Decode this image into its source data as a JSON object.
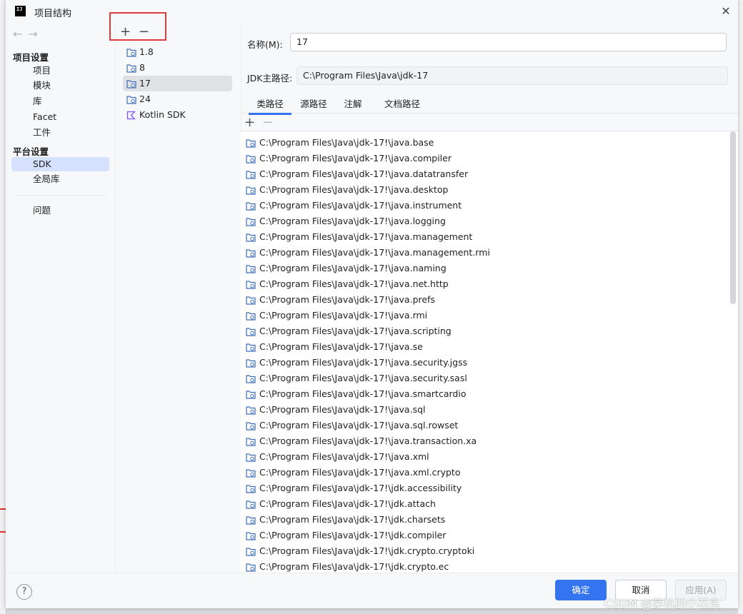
{
  "window": {
    "title": "项目结构",
    "close": "✕"
  },
  "nav": {
    "back": "←",
    "forward": "→",
    "section_project": "项目设置",
    "project_items": [
      "项目",
      "模块",
      "库",
      "Facet",
      "工件"
    ],
    "section_platform": "平台设置",
    "platform_items": [
      "SDK",
      "全局库"
    ],
    "problems": "问题",
    "selected": "SDK"
  },
  "sdk_panel": {
    "add": "+",
    "remove": "−",
    "items": [
      {
        "label": "1.8",
        "icon": "jdk-folder-icon"
      },
      {
        "label": "8",
        "icon": "jdk-folder-icon"
      },
      {
        "label": "17",
        "icon": "jdk-folder-icon"
      },
      {
        "label": "24",
        "icon": "jdk-folder-icon"
      },
      {
        "label": "Kotlin SDK",
        "icon": "kotlin-icon"
      }
    ],
    "selected": "17"
  },
  "detail": {
    "name_label": "名称(M):",
    "name_value": "17",
    "home_label": "JDK主路径:",
    "home_value": "C:\\Program Files\\Java\\jdk-17",
    "tabs": [
      "类路径",
      "源路径",
      "注解",
      "文档路径"
    ],
    "active_tab": "类路径",
    "list_add": "+",
    "list_remove": "−",
    "classpath": [
      "C:\\Program Files\\Java\\jdk-17!\\java.base",
      "C:\\Program Files\\Java\\jdk-17!\\java.compiler",
      "C:\\Program Files\\Java\\jdk-17!\\java.datatransfer",
      "C:\\Program Files\\Java\\jdk-17!\\java.desktop",
      "C:\\Program Files\\Java\\jdk-17!\\java.instrument",
      "C:\\Program Files\\Java\\jdk-17!\\java.logging",
      "C:\\Program Files\\Java\\jdk-17!\\java.management",
      "C:\\Program Files\\Java\\jdk-17!\\java.management.rmi",
      "C:\\Program Files\\Java\\jdk-17!\\java.naming",
      "C:\\Program Files\\Java\\jdk-17!\\java.net.http",
      "C:\\Program Files\\Java\\jdk-17!\\java.prefs",
      "C:\\Program Files\\Java\\jdk-17!\\java.rmi",
      "C:\\Program Files\\Java\\jdk-17!\\java.scripting",
      "C:\\Program Files\\Java\\jdk-17!\\java.se",
      "C:\\Program Files\\Java\\jdk-17!\\java.security.jgss",
      "C:\\Program Files\\Java\\jdk-17!\\java.security.sasl",
      "C:\\Program Files\\Java\\jdk-17!\\java.smartcardio",
      "C:\\Program Files\\Java\\jdk-17!\\java.sql",
      "C:\\Program Files\\Java\\jdk-17!\\java.sql.rowset",
      "C:\\Program Files\\Java\\jdk-17!\\java.transaction.xa",
      "C:\\Program Files\\Java\\jdk-17!\\java.xml",
      "C:\\Program Files\\Java\\jdk-17!\\java.xml.crypto",
      "C:\\Program Files\\Java\\jdk-17!\\jdk.accessibility",
      "C:\\Program Files\\Java\\jdk-17!\\jdk.attach",
      "C:\\Program Files\\Java\\jdk-17!\\jdk.charsets",
      "C:\\Program Files\\Java\\jdk-17!\\jdk.compiler",
      "C:\\Program Files\\Java\\jdk-17!\\jdk.crypto.cryptoki",
      "C:\\Program Files\\Java\\jdk-17!\\jdk.crypto.ec"
    ]
  },
  "footer": {
    "help": "?",
    "ok": "确定",
    "cancel": "取消",
    "apply": "应用(A)"
  },
  "watermark": "CSDN @茅坑的小石头",
  "colors": {
    "accent": "#3574f0",
    "selection_nav": "#d5e1ff",
    "selection_list": "#dfe1e5",
    "highlight_box": "#e0393e",
    "kotlin": "#7f52ff"
  }
}
